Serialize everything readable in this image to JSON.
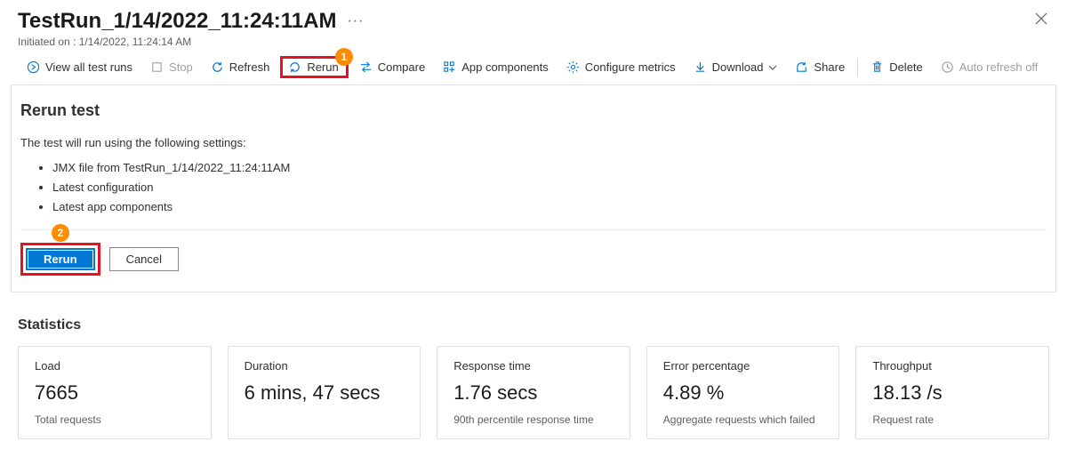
{
  "header": {
    "title": "TestRun_1/14/2022_11:24:11AM",
    "subtitle": "Initiated on : 1/14/2022, 11:24:14 AM"
  },
  "toolbar": {
    "view_all": "View all test runs",
    "stop": "Stop",
    "refresh": "Refresh",
    "rerun": "Rerun",
    "compare": "Compare",
    "app_components": "App components",
    "configure_metrics": "Configure metrics",
    "download": "Download",
    "share": "Share",
    "delete": "Delete",
    "auto_refresh": "Auto refresh off"
  },
  "callouts": {
    "one": "1",
    "two": "2"
  },
  "rerun_panel": {
    "title": "Rerun test",
    "desc": "The test will run using the following settings:",
    "items": [
      "JMX file from TestRun_1/14/2022_11:24:11AM",
      "Latest configuration",
      "Latest app components"
    ],
    "primary": "Rerun",
    "cancel": "Cancel"
  },
  "stats_title": "Statistics",
  "stats": [
    {
      "label": "Load",
      "value": "7665",
      "sub": "Total requests"
    },
    {
      "label": "Duration",
      "value": "6 mins, 47 secs",
      "sub": ""
    },
    {
      "label": "Response time",
      "value": "1.76 secs",
      "sub": "90th percentile response time"
    },
    {
      "label": "Error percentage",
      "value": "4.89 %",
      "sub": "Aggregate requests which failed"
    },
    {
      "label": "Throughput",
      "value": "18.13 /s",
      "sub": "Request rate"
    }
  ]
}
